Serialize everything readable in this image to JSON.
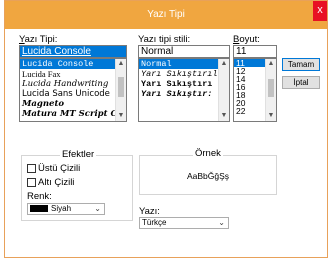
{
  "dialog": {
    "title": "Yazı Tipi",
    "close_label": "x"
  },
  "font": {
    "label_pre": "Y",
    "label_rest": "azı Tipi:",
    "value": "Lucida Console",
    "items": [
      "Lucida Console",
      "Lucida Fax",
      "Lucida Handwriting",
      "Lucida Sans Unicode",
      "Magneto",
      "Matura MT Script Capi"
    ]
  },
  "style": {
    "label": "Yazı tipi stili:",
    "value": "Normal",
    "items": [
      "Normal",
      "Yarı Sıkıştırıl",
      "Yarı Sıkıştırı",
      "Yarı Sıkıştır:"
    ]
  },
  "size": {
    "label_pre": "B",
    "label_rest": "oyut:",
    "value": "11",
    "items": [
      "11",
      "12",
      "14",
      "16",
      "18",
      "20",
      "22"
    ]
  },
  "buttons": {
    "ok": "Tamam",
    "cancel": "İptal"
  },
  "effects": {
    "title": "Efektler",
    "strikeout": "Üstü Çizili",
    "underline": "Altı Çizili",
    "color_label": "Renk:",
    "color_value": "Siyah",
    "color_hex": "#000000"
  },
  "sample": {
    "title": "Örnek",
    "text": "AaBbĞğŞş"
  },
  "script": {
    "label": "Yazı:",
    "value": "Türkçe"
  }
}
